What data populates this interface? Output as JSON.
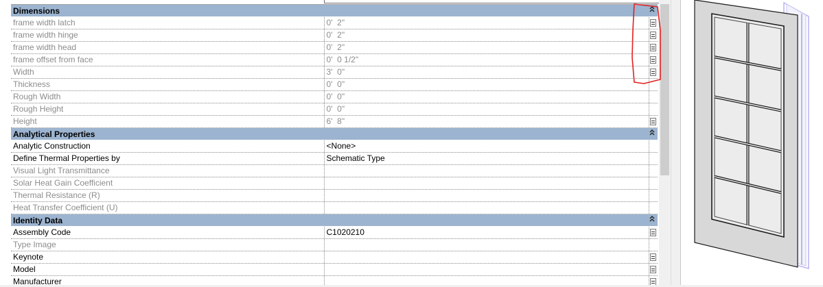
{
  "groups": [
    {
      "title": "Dimensions",
      "collapse_glyph": "≈",
      "rows": [
        {
          "name": "frame width latch",
          "value": "0'  2\"",
          "disabled": true,
          "has_button": true
        },
        {
          "name": "frame width hinge",
          "value": "0'  2\"",
          "disabled": true,
          "has_button": true
        },
        {
          "name": "frame width head",
          "value": "0'  2\"",
          "disabled": true,
          "has_button": true
        },
        {
          "name": "frame offset from face",
          "value": "0'  0 1/2\"",
          "disabled": true,
          "has_button": true
        },
        {
          "name": "Width",
          "value": "3'  0\"",
          "disabled": true,
          "has_button": true
        },
        {
          "name": "Thickness",
          "value": "0'  0\"",
          "disabled": true,
          "has_button": false
        },
        {
          "name": "Rough Width",
          "value": "0'  0\"",
          "disabled": true,
          "has_button": false
        },
        {
          "name": "Rough Height",
          "value": "0'  0\"",
          "disabled": true,
          "has_button": false
        },
        {
          "name": "Height",
          "value": "6'  8\"",
          "disabled": true,
          "has_button": true
        }
      ]
    },
    {
      "title": "Analytical Properties",
      "collapse_glyph": "≈",
      "rows": [
        {
          "name": "Analytic Construction",
          "value": "<None>",
          "disabled": false,
          "has_button": false
        },
        {
          "name": "Define Thermal Properties by",
          "value": "Schematic Type",
          "disabled": false,
          "has_button": false
        },
        {
          "name": "Visual Light Transmittance",
          "value": "",
          "disabled": true,
          "has_button": false
        },
        {
          "name": "Solar Heat Gain Coefficient",
          "value": "",
          "disabled": true,
          "has_button": false
        },
        {
          "name": "Thermal Resistance (R)",
          "value": "",
          "disabled": true,
          "has_button": false
        },
        {
          "name": "Heat Transfer Coefficient (U)",
          "value": "",
          "disabled": true,
          "has_button": false
        }
      ]
    },
    {
      "title": "Identity Data",
      "collapse_glyph": "≈",
      "rows": [
        {
          "name": "Assembly Code",
          "value": "C1020210",
          "disabled": false,
          "has_button": true
        },
        {
          "name": "Type Image",
          "value": "",
          "disabled": true,
          "has_button": false
        },
        {
          "name": "Keynote",
          "value": "",
          "disabled": false,
          "has_button": true
        },
        {
          "name": "Model",
          "value": "",
          "disabled": false,
          "has_button": true
        },
        {
          "name": "Manufacturer",
          "value": "",
          "disabled": false,
          "has_button": true
        }
      ]
    }
  ],
  "colors": {
    "group_header": "#9cb4d0",
    "annotation": "#e02020",
    "door_frame": "#d8d8d8",
    "door_glass_outline": "#1a1a1a",
    "door_edge": "#b8b4f0"
  },
  "icons": {
    "collapse": "double-chevron-up-icon",
    "edit_button": "ellipsis-edit-icon"
  },
  "preview": {
    "subject": "door-preview-3d",
    "glazing_columns": 2,
    "glazing_rows": 5
  }
}
